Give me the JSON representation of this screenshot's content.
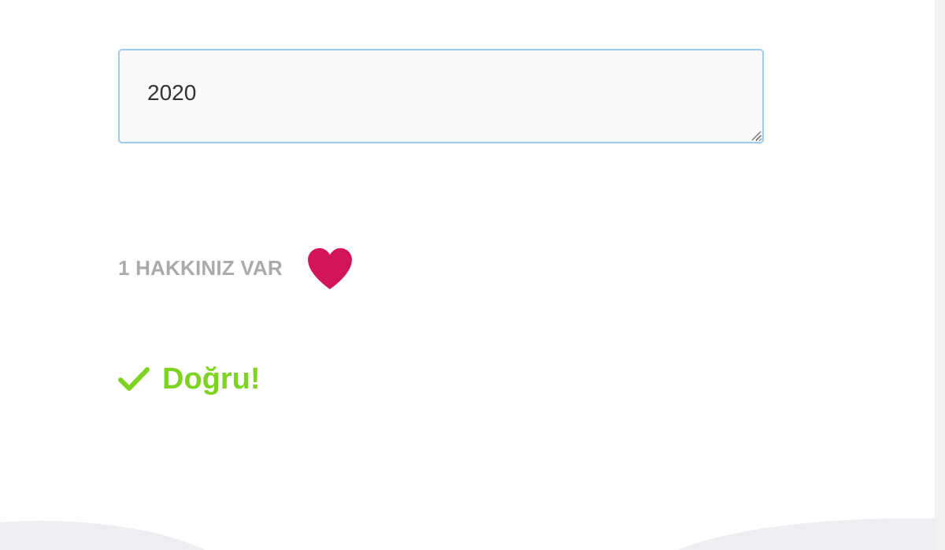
{
  "answer": {
    "value": "2020"
  },
  "lives": {
    "label": "1 HAKKINIZ VAR",
    "icon": "heart-icon",
    "icon_color": "#d4145a"
  },
  "result": {
    "icon": "check-icon",
    "text": "Doğru!",
    "color": "#7ed321"
  },
  "colors": {
    "input_border": "#9ccaf0",
    "input_background": "#f9f9f9",
    "muted_text": "#aaaaaa",
    "wave": "#ededf2"
  }
}
